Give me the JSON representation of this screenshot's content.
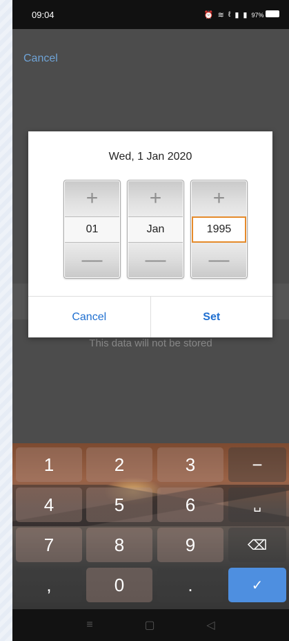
{
  "status_bar": {
    "time": "09:04",
    "icons": [
      "alarm-icon",
      "wifi-icon",
      "volte-icon",
      "signal-4g-icon",
      "signal-icon"
    ],
    "battery": "97%"
  },
  "background": {
    "cancel_label": "Cancel",
    "note": "This data will not be stored"
  },
  "dialog": {
    "title": "Wed, 1 Jan 2020",
    "day": "01",
    "month": "Jan",
    "year": "1995",
    "plus": "+",
    "minus": "—",
    "cancel_label": "Cancel",
    "set_label": "Set",
    "accent_color": "#1f6fd0",
    "focus_color": "#e58a2a"
  },
  "keyboard": {
    "rows": [
      [
        "1",
        "2",
        "3",
        "−"
      ],
      [
        "4",
        "5",
        "6",
        "␣"
      ],
      [
        "7",
        "8",
        "9",
        "⌫"
      ],
      [
        ",",
        "0",
        ".",
        "✓"
      ]
    ],
    "done_color": "#4e8fe0"
  },
  "nav_bar": {
    "menu": "≡",
    "home": "▢",
    "back": "◁"
  }
}
